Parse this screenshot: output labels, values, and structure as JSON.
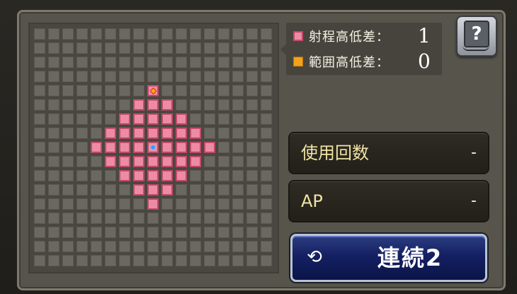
{
  "legend": {
    "range_label": "射程高低差：",
    "range_value": "1",
    "area_label": "範囲高低差：",
    "area_value": "0",
    "range_color": "#ee8ba4",
    "area_color": "#f2a21c"
  },
  "help": {
    "icon": "question-book-icon",
    "label": "?"
  },
  "stats": {
    "uses_label": "使用回数",
    "uses_value": "-",
    "ap_label": "AP",
    "ap_value": "-"
  },
  "chain_button": {
    "icon": "cycle-arrows-icon",
    "label": "連続2"
  },
  "range_grid": {
    "rows": 17,
    "cols": 17,
    "origin": [
      8,
      8
    ],
    "highlighted_rows": [
      {
        "row": 4,
        "cols": [
          8
        ]
      },
      {
        "row": 5,
        "cols": [
          7,
          8,
          9
        ]
      },
      {
        "row": 6,
        "cols": [
          6,
          7,
          8,
          9,
          10
        ]
      },
      {
        "row": 7,
        "cols": [
          5,
          6,
          7,
          8,
          9,
          10,
          11
        ]
      },
      {
        "row": 8,
        "cols": [
          4,
          5,
          6,
          7,
          8,
          9,
          10,
          11,
          12
        ]
      },
      {
        "row": 9,
        "cols": [
          5,
          6,
          7,
          8,
          9,
          10,
          11
        ]
      },
      {
        "row": 10,
        "cols": [
          6,
          7,
          8,
          9,
          10
        ]
      },
      {
        "row": 11,
        "cols": [
          7,
          8,
          9
        ]
      },
      {
        "row": 12,
        "cols": [
          8
        ]
      }
    ],
    "marked_cell": [
      4,
      8
    ]
  }
}
